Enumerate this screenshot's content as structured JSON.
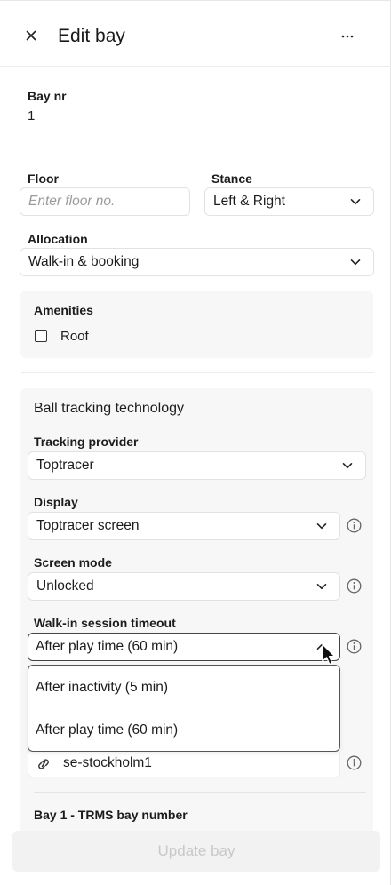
{
  "header": {
    "title": "Edit bay"
  },
  "bay": {
    "label": "Bay nr",
    "value": "1"
  },
  "floor": {
    "label": "Floor",
    "placeholder": "Enter floor no."
  },
  "stance": {
    "label": "Stance",
    "value": "Left & Right"
  },
  "allocation": {
    "label": "Allocation",
    "value": "Walk-in & booking"
  },
  "amenities": {
    "label": "Amenities",
    "items": [
      {
        "label": "Roof",
        "checked": false
      }
    ]
  },
  "tracking": {
    "section_title": "Ball tracking technology",
    "provider": {
      "label": "Tracking provider",
      "value": "Toptracer"
    },
    "display": {
      "label": "Display",
      "value": "Toptracer screen"
    },
    "screen_mode": {
      "label": "Screen mode",
      "value": "Unlocked"
    },
    "timeout": {
      "label": "Walk-in session timeout",
      "value": "After play time (60 min)",
      "options": [
        "After inactivity (5 min)",
        "After play time (60 min)"
      ]
    },
    "site": {
      "value": "se-stockholm1"
    },
    "trms": {
      "label": "Bay 1 - TRMS bay number"
    }
  },
  "footer": {
    "update_label": "Update bay"
  },
  "colors": {
    "accent_disabled": "#c8c8c8",
    "panel_bg": "#f7f7f7",
    "border": "#e2e2e2"
  }
}
